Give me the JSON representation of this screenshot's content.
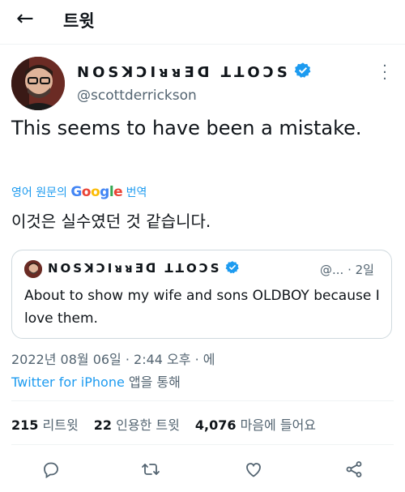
{
  "header": {
    "back_label": "←",
    "title": "트윗"
  },
  "author": {
    "display_name": "NOSꓘƆIᴚᴚƎᗡ ꓕꓕOƆS",
    "handle": "@scottderrickson",
    "verified": true
  },
  "tweet": {
    "text": "This seems to have been a mistake.",
    "translate_prefix": "영어 원문의",
    "translate_brand": "Google",
    "translate_suffix": "번역",
    "translated_text": "이것은 실수였던 것 같습니다."
  },
  "quote": {
    "display_name": "NOSꓘƆIᴚᴚƎᗡ ꓕꓕOƆS",
    "meta": "@... · 2일",
    "text": "About to show my wife and sons OLDBOY because I love them."
  },
  "timestamp": "2022년 08월 06일 · 2:44 오후 · 에",
  "source": {
    "client": "Twitter for iPhone",
    "suffix": "앱을 통해"
  },
  "stats": {
    "retweets": "215",
    "retweets_label": "리트윗",
    "quotes": "22",
    "quotes_label": "인용한 트윗",
    "likes": "4,076",
    "likes_label": "마음에 들어요"
  },
  "colors": {
    "accent": "#1d9bf0",
    "muted": "#536471",
    "text": "#0f1419",
    "border": "#cfd9de"
  },
  "icons": [
    "back-arrow-icon",
    "verified-badge-icon",
    "more-icon",
    "reply-icon",
    "retweet-icon",
    "like-icon",
    "share-icon"
  ]
}
